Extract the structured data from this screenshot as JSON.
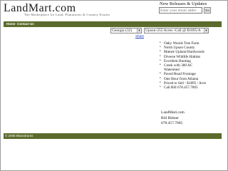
{
  "header": {
    "logo_text": "LandMart.com",
    "tagline": "The Marketplace for Land, Plantations & Country Estates",
    "updates_title": "New Releases & Updates",
    "email_placeholder": "Enter your email addre",
    "go_label": "Go"
  },
  "nav": {
    "home": "Home",
    "contact_us": "Contact Us"
  },
  "filters": {
    "county_selected": "Georgia (32)",
    "property_selected": "Upson-255 Acres -Call @ $1895/A"
  },
  "share_label": "Share",
  "features": [
    "Oaky Woods Tree Farm",
    "North Upson County",
    "Mature Upland Hardwoods",
    "Diverse Wildlife Habitat",
    "Excellent Hunting",
    "Creek with 300 AC Watershed",
    "Paved Road Frontage",
    "One Hour from Atlanta",
    "Priced to Sell - $1895 / Acre",
    "Call Bill 678.457.7005"
  ],
  "contact": {
    "site": "LandMart.com",
    "name": "Bill Bittner",
    "phone": "678.457.7005"
  },
  "footer": {
    "copyright": "© 2008 Bluecitrams"
  },
  "colors": {
    "nav_green": "#5a6b2c",
    "link_blue": "#1d3fbf"
  }
}
